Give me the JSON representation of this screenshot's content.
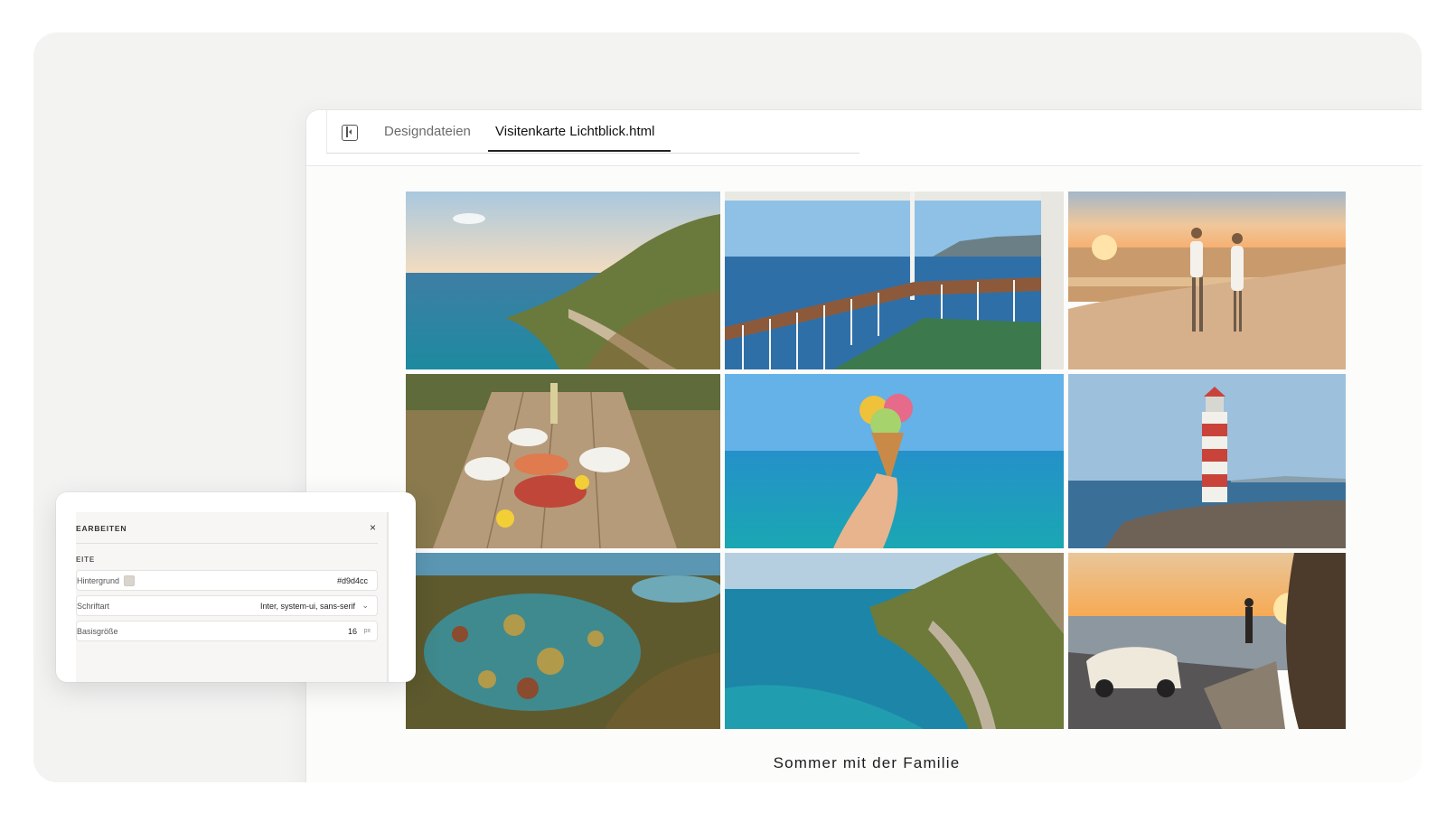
{
  "colors": {
    "stage_bg": "#f3f3f2",
    "window_bg": "#fcfcfb",
    "tab_active": "#111111",
    "tab_inactive": "#6b6b6b",
    "hintergrund_swatch": "#d9d4cc"
  },
  "tabs": {
    "toggle_icon": "panel-toggle-icon",
    "files_label": "Designdateien",
    "active_label": "Visitenkarte Lichtblick.html"
  },
  "gallery": {
    "caption": "Sommer mit der Familie",
    "photos": [
      "Küstenstraße an Klippen",
      "Fährdeck mit Geländer",
      "Paar am Strand bei Sonnenuntergang",
      "Picknicktisch mit Meeresfrüchten",
      "Eistüte vor dem Meer",
      "Rot-weißer Leuchtturm",
      "Gezeitentümpel",
      "Serpentinenstraße am Meer",
      "Cabrio an der Küste bei Sonnenuntergang"
    ]
  },
  "editor": {
    "title": "EARBEITEN",
    "close_icon": "×",
    "section": "EITE",
    "fields": [
      {
        "label": "Hintergrund",
        "value": "#d9d4cc"
      },
      {
        "label": "Schriftart",
        "value": "Inter, system-ui, sans-serif",
        "chevron": "⌄"
      },
      {
        "label": "Basisgröße",
        "value": "16",
        "unit": "px"
      }
    ]
  }
}
